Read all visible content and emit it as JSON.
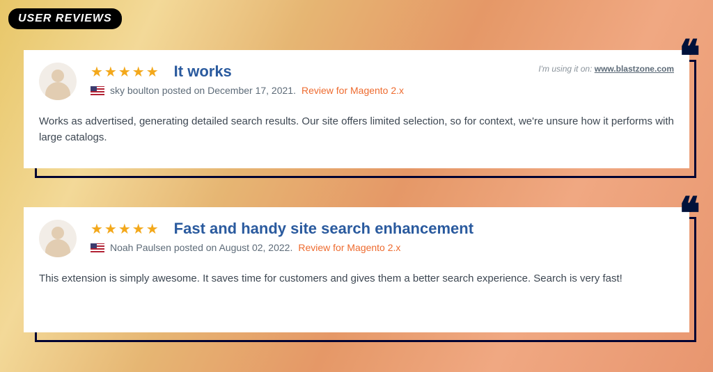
{
  "section_label": "USER REVIEWS",
  "reviews": [
    {
      "title": "It works",
      "stars": "★★★★★",
      "author": "sky boulton",
      "posted_label": "posted on",
      "date": "December 17, 2021.",
      "review_for": "Review for Magento 2.x",
      "using_label": "I'm using it on:",
      "using_site": "www.blastzone.com",
      "body": "Works as advertised, generating detailed search results. Our site offers limited selection, so for context, we're unsure how it performs with large catalogs."
    },
    {
      "title": "Fast and handy site search enhancement",
      "stars": "★★★★★",
      "author": "Noah Paulsen",
      "posted_label": "posted on",
      "date": "August 02, 2022.",
      "review_for": "Review for Magento 2.x",
      "using_label": "",
      "using_site": "",
      "body": "This extension is simply awesome. It saves time for customers and gives them a better search experience. Search is very fast!"
    }
  ]
}
